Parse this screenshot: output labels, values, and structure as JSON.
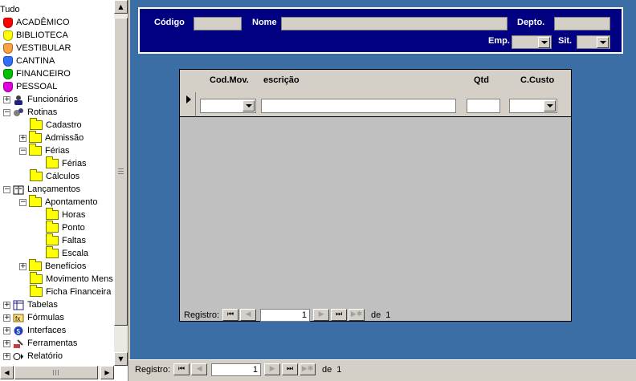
{
  "tree": {
    "root_label": "Tudo",
    "modules": [
      {
        "label": "ACADÊMICO",
        "color": "#ff0000"
      },
      {
        "label": "BIBLIOTECA",
        "color": "#ffff00"
      },
      {
        "label": "VESTIBULAR",
        "color": "#ffa040"
      },
      {
        "label": "CANTINA",
        "color": "#3070ff"
      },
      {
        "label": "FINANCEIRO",
        "color": "#00c000"
      },
      {
        "label": "PESSOAL",
        "color": "#e000e0"
      }
    ],
    "nodes": {
      "funcionarios": "Funcionários",
      "rotinas": "Rotinas",
      "cadastro": "Cadastro",
      "admissao": "Admissão",
      "ferias": "Férias",
      "ferias_sub": "Férias",
      "calculos": "Cálculos",
      "lancamentos": "Lançamentos",
      "apontamento": "Apontamento",
      "horas": "Horas",
      "ponto": "Ponto",
      "faltas": "Faltas",
      "escala": "Escala",
      "beneficios": "Benefícios",
      "movimento": "Movimento Mens",
      "ficha": "Ficha Financeira",
      "tabelas": "Tabelas",
      "formulas": "Fórmulas",
      "interfaces": "Interfaces",
      "ferramentas": "Ferramentas",
      "relatorio": "Relatório"
    }
  },
  "header": {
    "codigo_label": "Código",
    "nome_label": "Nome",
    "depto_label": "Depto.",
    "emp_label": "Emp.",
    "sit_label": "Sit."
  },
  "subform": {
    "columns": [
      "Cod.Mov.",
      "escrição",
      "Qtd",
      "C.Custo"
    ],
    "nav": {
      "label": "Registro:",
      "current": "1",
      "of_label": "de",
      "total": "1"
    }
  },
  "main_nav": {
    "label": "Registro:",
    "current": "1",
    "of_label": "de",
    "total": "1"
  },
  "icons": {
    "first": "⏮",
    "prev": "◀",
    "next": "▶",
    "last": "⏭",
    "new": "▶✱",
    "up": "▲",
    "down": "▼",
    "left": "◀",
    "right": "▶"
  }
}
